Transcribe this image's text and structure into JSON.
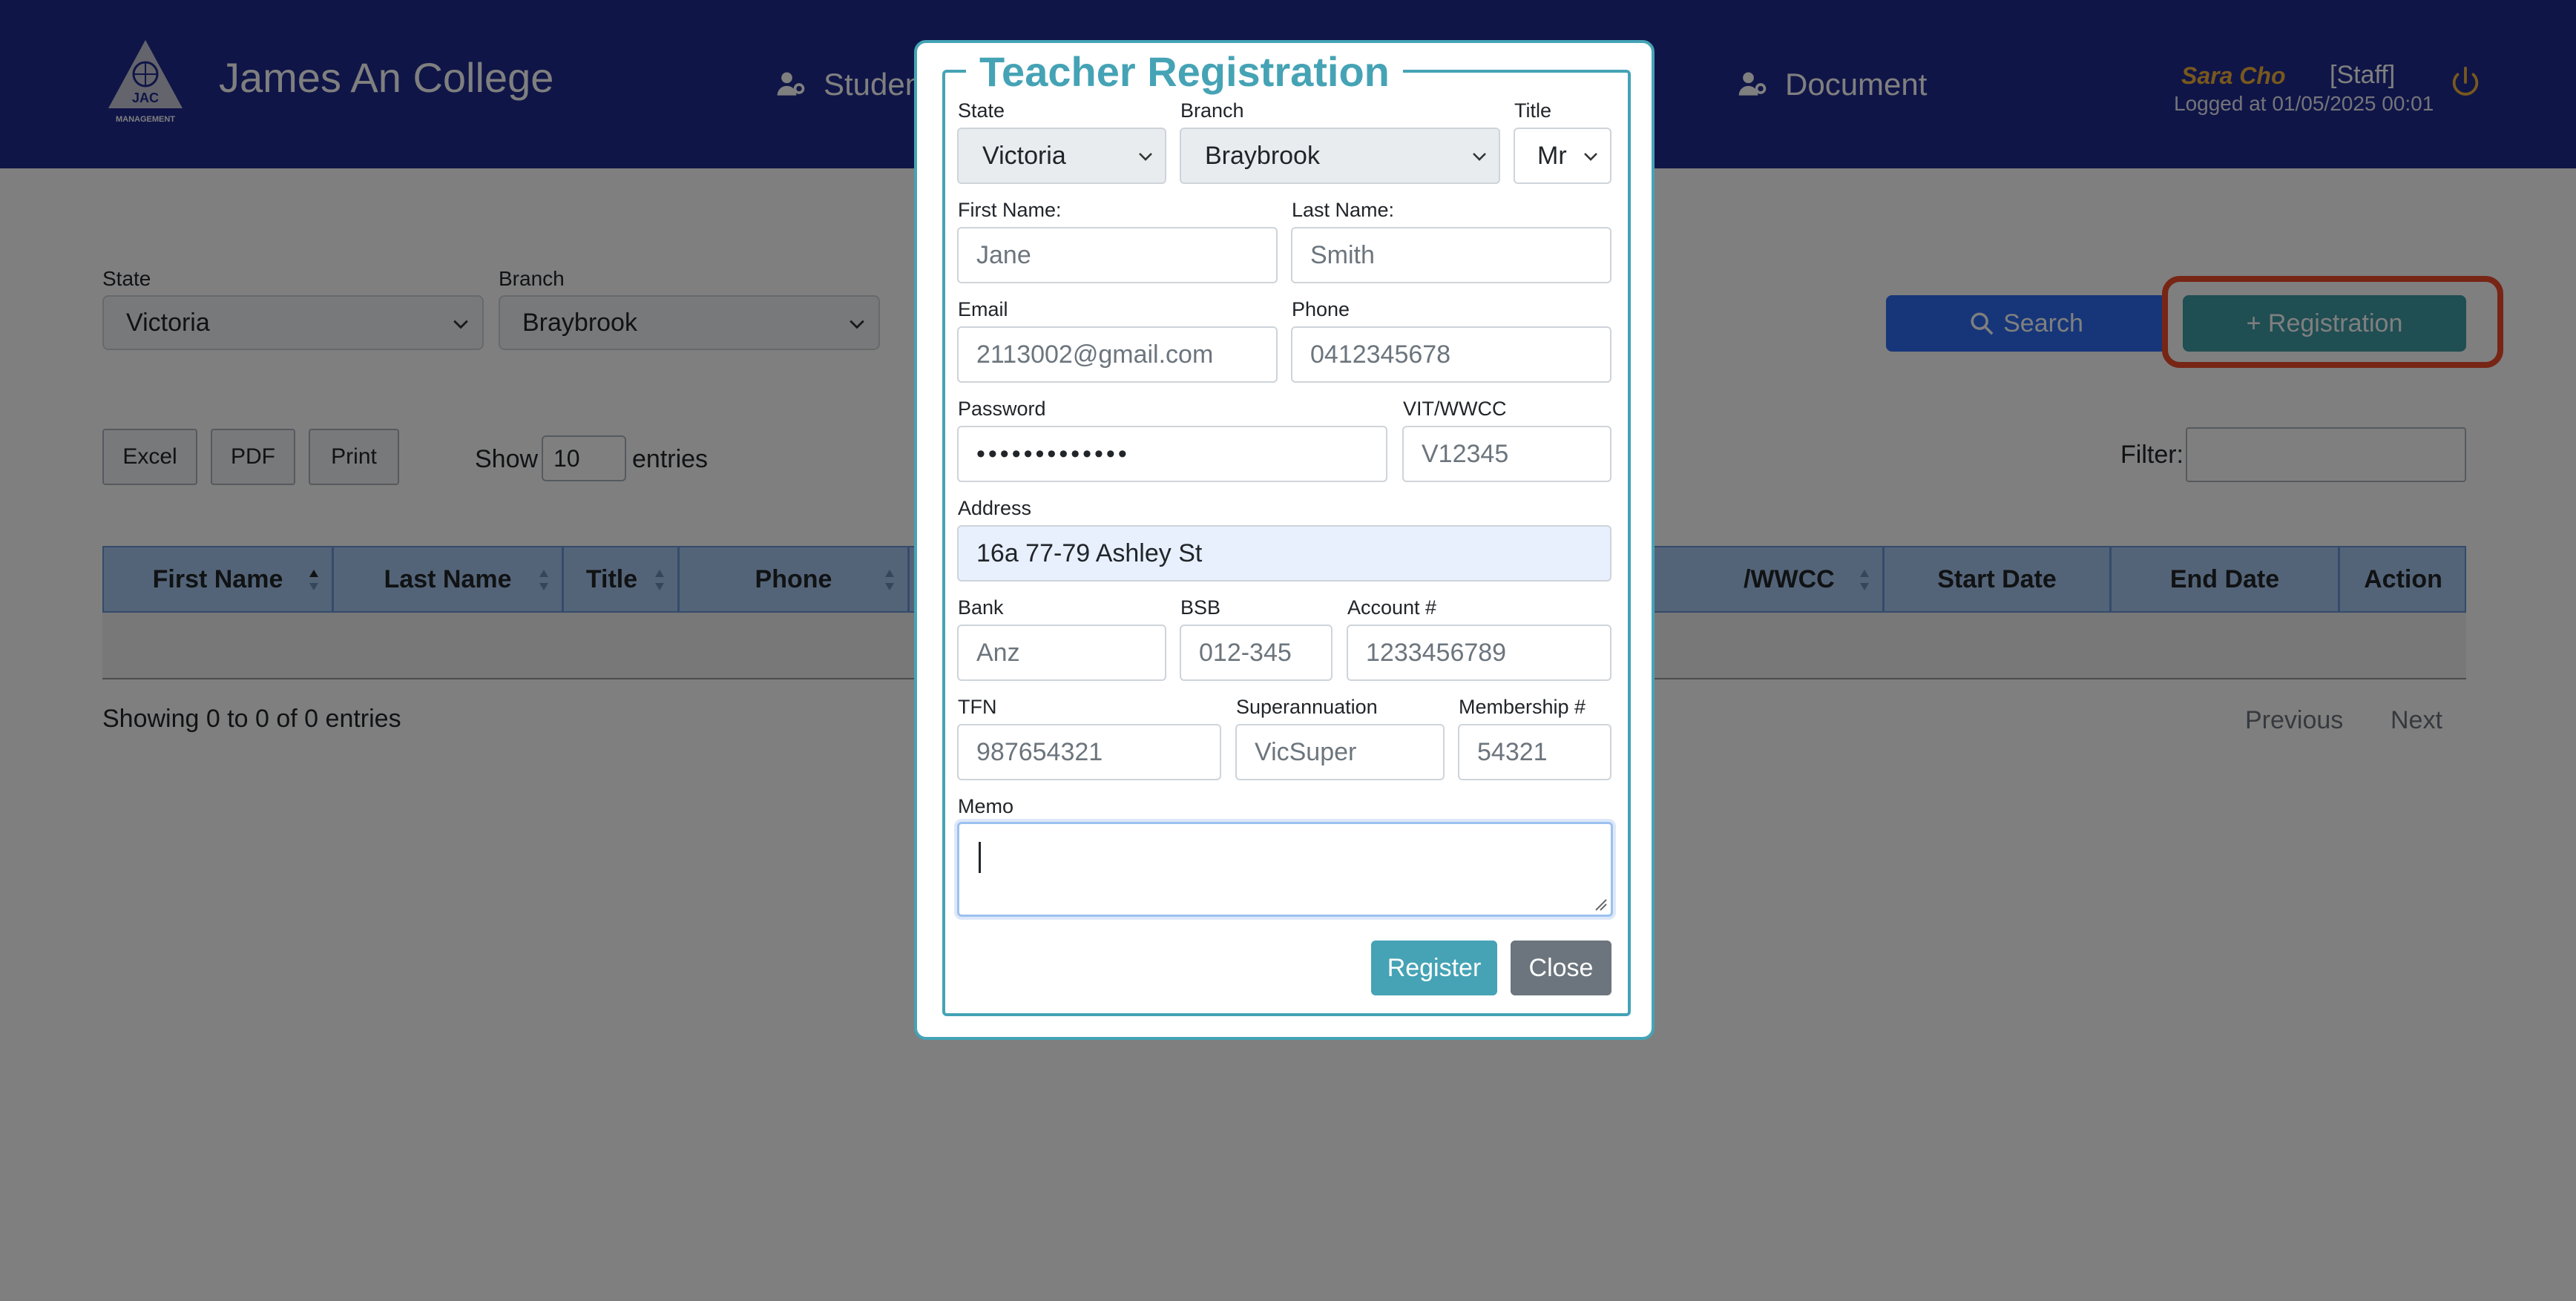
{
  "header": {
    "brand": "James An College",
    "logo_text": "JAC MANAGEMENT",
    "nav": [
      {
        "label": "Studen",
        "icon": "user-gear-icon"
      },
      {
        "label": "Document",
        "icon": "user-gear-icon"
      }
    ],
    "user": {
      "name": "Sara Cho",
      "role": "[Staff]",
      "login": "Logged at 01/05/2025 00:01"
    }
  },
  "filters": {
    "state_label": "State",
    "state_value": "Victoria",
    "branch_label": "Branch",
    "branch_value": "Braybrook",
    "search_label": "Search",
    "registration_label": "+ Registration"
  },
  "toolbar": {
    "excel": "Excel",
    "pdf": "PDF",
    "print": "Print",
    "show_label": "Show",
    "entries_value": "10",
    "entries_label": "entries",
    "filter_label": "Filter:"
  },
  "table": {
    "columns": [
      "First Name",
      "Last Name",
      "Title",
      "Phone",
      "/WWCC",
      "Start Date",
      "End Date",
      "Action"
    ],
    "showing": "Showing 0 to 0 of 0 entries",
    "previous": "Previous",
    "next": "Next"
  },
  "modal": {
    "title": "Teacher Registration",
    "state": {
      "label": "State",
      "value": "Victoria"
    },
    "branch": {
      "label": "Branch",
      "value": "Braybrook"
    },
    "title_field": {
      "label": "Title",
      "value": "Mr"
    },
    "first_name": {
      "label": "First Name:",
      "value": "Jane"
    },
    "last_name": {
      "label": "Last Name:",
      "value": "Smith"
    },
    "email": {
      "label": "Email",
      "value": "2113002@gmail.com"
    },
    "phone": {
      "label": "Phone",
      "value": "0412345678"
    },
    "password": {
      "label": "Password",
      "value": "•••••••••••••"
    },
    "vit": {
      "label": "VIT/WWCC",
      "value": "V12345"
    },
    "address": {
      "label": "Address",
      "value": "16a 77-79 Ashley St"
    },
    "bank": {
      "label": "Bank",
      "value": "Anz"
    },
    "bsb": {
      "label": "BSB",
      "value": "012-345"
    },
    "account": {
      "label": "Account #",
      "value": "1233456789"
    },
    "tfn": {
      "label": "TFN",
      "value": "987654321"
    },
    "super": {
      "label": "Superannuation",
      "value": "VicSuper"
    },
    "membership": {
      "label": "Membership #",
      "value": "54321"
    },
    "memo": {
      "label": "Memo",
      "value": ""
    },
    "register": "Register",
    "close": "Close"
  },
  "colors": {
    "header_bg": "#1f2b8f",
    "accent": "#45a3b5",
    "search_button": "#2d6cf3",
    "highlight": "#ee4b2b",
    "user_name": "#f0b13c"
  }
}
